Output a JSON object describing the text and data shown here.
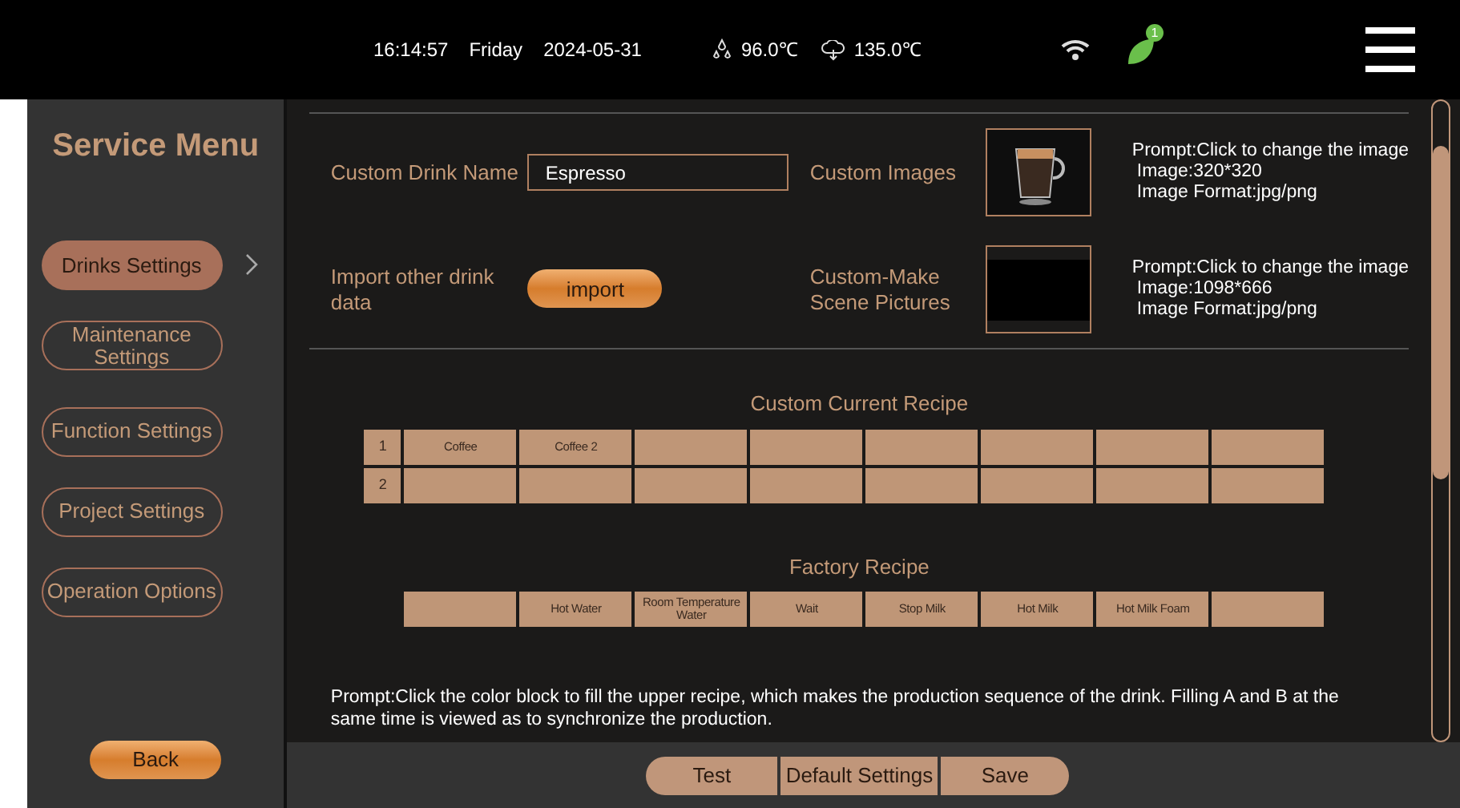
{
  "status_bar": {
    "time": "16:14:57",
    "day": "Friday",
    "date": "2024-05-31",
    "water_temp": "96.0℃",
    "steam_temp": "135.0℃",
    "notification_count": "1"
  },
  "sidebar": {
    "title": "Service Menu",
    "items": [
      {
        "label": "Drinks Settings",
        "selected": true
      },
      {
        "label": "Maintenance Settings",
        "selected": false
      },
      {
        "label": "Function Settings",
        "selected": false
      },
      {
        "label": "Project Settings",
        "selected": false
      },
      {
        "label": "Operation Options",
        "selected": false
      }
    ],
    "back_button": "Back"
  },
  "form": {
    "drink_name_label": "Custom Drink Name",
    "drink_name_value": "Espresso",
    "import_label": "Import other drink data",
    "import_button": "import",
    "custom_images_label": "Custom Images",
    "custom_images_prompt": [
      "Prompt:Click to change the image",
      "Image:320*320",
      "Image Format:jpg/png"
    ],
    "scene_label": "Custom-Make Scene Pictures",
    "scene_prompt": [
      "Prompt:Click to change the image",
      "Image:1098*666",
      "Image Format:jpg/png"
    ]
  },
  "custom_recipe": {
    "title": "Custom Current Recipe",
    "rows": [
      {
        "index": "1",
        "cells": [
          "Coffee",
          "Coffee 2"
        ]
      },
      {
        "index": "2",
        "cells": []
      }
    ]
  },
  "factory_recipe": {
    "title": "Factory Recipe",
    "cells": [
      "Hot Water",
      "Room Temperature Water",
      "Wait",
      "Stop Milk",
      "Hot Milk",
      "Hot Milk Foam"
    ]
  },
  "prompt": "Prompt:Click the color block to fill the upper recipe, which makes the production sequence of the drink. Filling A and B at the same time is viewed as to synchronize the production.",
  "bottom_buttons": [
    "Test",
    "Default Settings",
    "Save"
  ]
}
